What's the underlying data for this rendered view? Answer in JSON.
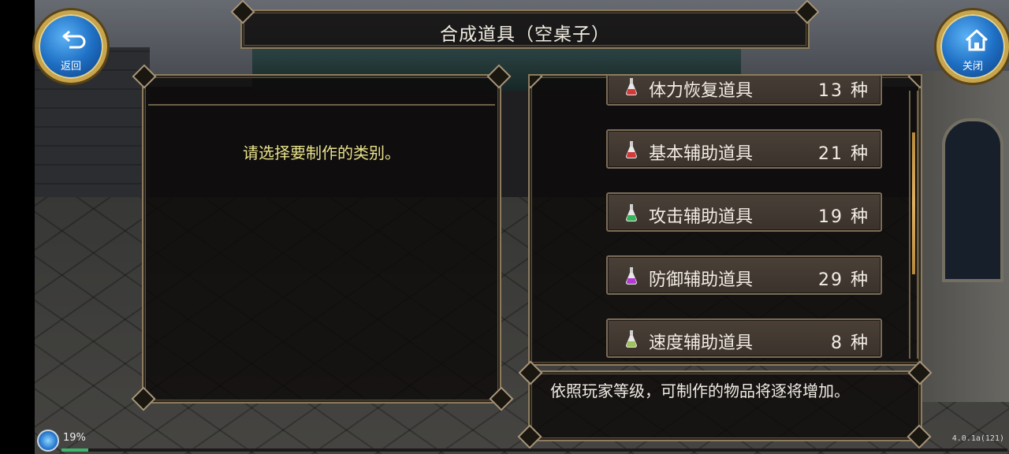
{
  "title": "合成道具（空桌子）",
  "buttons": {
    "back_label": "返回",
    "close_label": "关闭"
  },
  "left_panel": {
    "prompt": "请选择要制作的类别。"
  },
  "categories": [
    {
      "label": "体力恢复道具",
      "count": "13 种",
      "potion_color": "#d23a3a"
    },
    {
      "label": "基本辅助道具",
      "count": "21 种",
      "potion_color": "#d23a3a"
    },
    {
      "label": "攻击辅助道具",
      "count": "19 种",
      "potion_color": "#37b35a"
    },
    {
      "label": "防御辅助道具",
      "count": "29 种",
      "potion_color": "#b33ad2"
    },
    {
      "label": "速度辅助道具",
      "count": "8 种",
      "potion_color": "#9fc25a"
    }
  ],
  "info_text": "依照玩家等级，可制作的物品将逐将增加。",
  "status": {
    "battery": "19%",
    "progress_fraction": 0.19,
    "version": "4.0.1a(121)"
  },
  "colors": {
    "prompt": "#e9e28a",
    "frame_border": "#8c7b5e",
    "button_blue": "#1e6fc4",
    "button_gold": "#c8a44a"
  }
}
